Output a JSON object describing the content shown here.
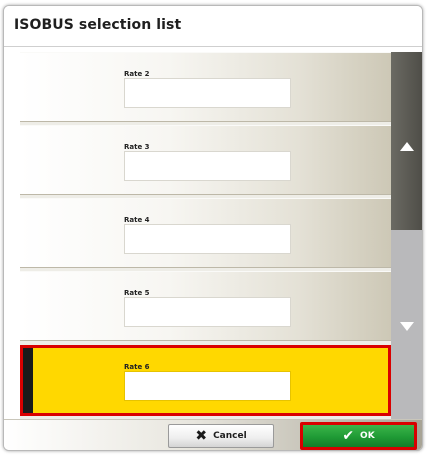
{
  "dialog": {
    "title": "ISOBUS selection list"
  },
  "list": {
    "items": [
      {
        "label": "Rate 2",
        "selected": false
      },
      {
        "label": "Rate 3",
        "selected": false
      },
      {
        "label": "Rate 4",
        "selected": false
      },
      {
        "label": "Rate 5",
        "selected": false
      },
      {
        "label": "Rate 6",
        "selected": true
      }
    ]
  },
  "scrollbar": {
    "up_icon": "triangle-up",
    "down_icon": "triangle-down"
  },
  "footer": {
    "cancel_label": "Cancel",
    "cancel_icon": "x-mark",
    "ok_label": "OK",
    "ok_icon": "checkmark"
  },
  "colors": {
    "selected_row": "#ffd800",
    "highlight_border": "#d90000",
    "ok_button": "#1f9a35",
    "scroll_thumb": "#4f4e48"
  }
}
